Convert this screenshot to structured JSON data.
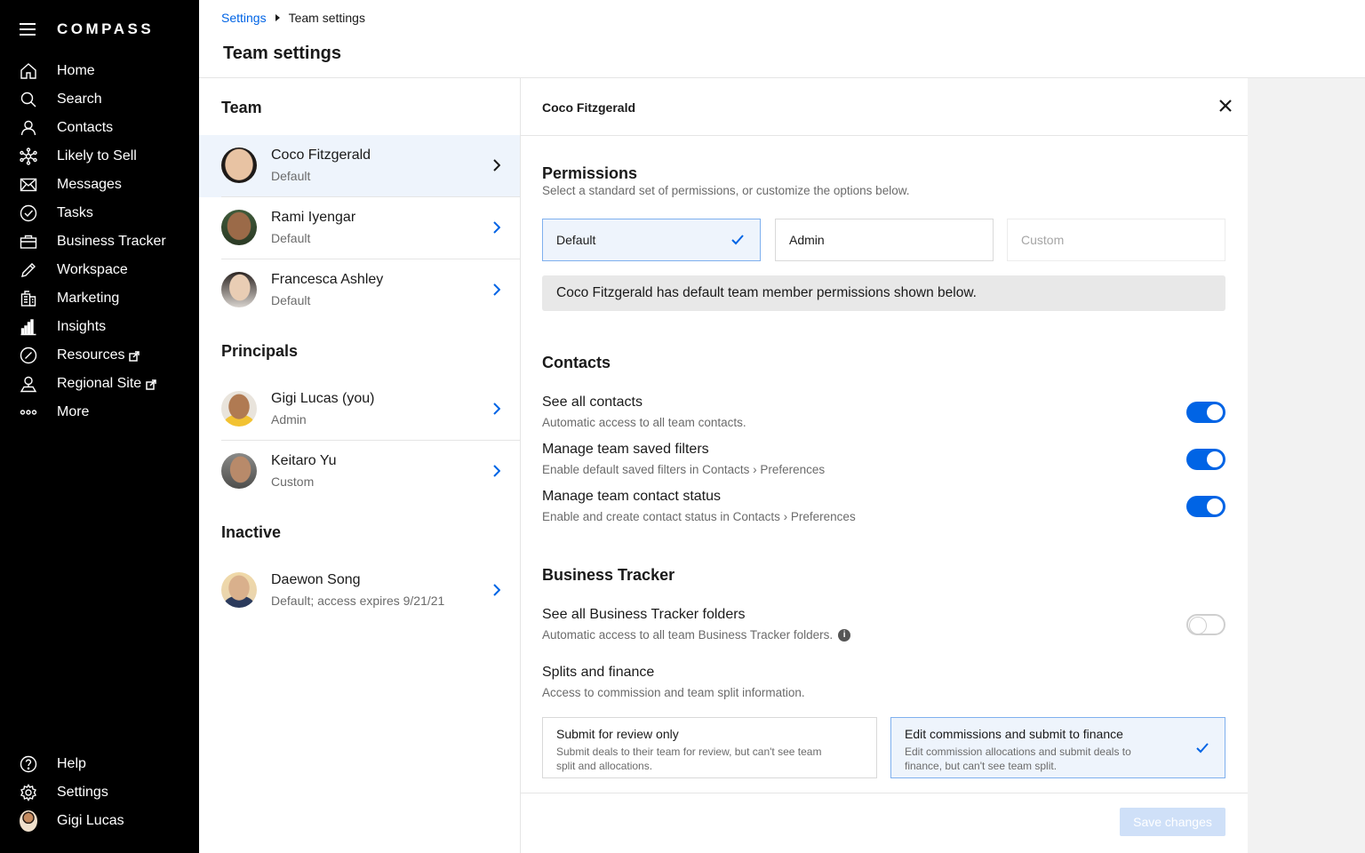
{
  "app": {
    "logo": "COMPASS"
  },
  "sidebar": {
    "items": [
      {
        "label": "Home",
        "icon": "home-icon"
      },
      {
        "label": "Search",
        "icon": "search-icon"
      },
      {
        "label": "Contacts",
        "icon": "contacts-icon"
      },
      {
        "label": "Likely to Sell",
        "icon": "network-icon"
      },
      {
        "label": "Messages",
        "icon": "mail-icon"
      },
      {
        "label": "Tasks",
        "icon": "check-circle-icon"
      },
      {
        "label": "Business Tracker",
        "icon": "briefcase-icon"
      },
      {
        "label": "Workspace",
        "icon": "pencil-icon"
      },
      {
        "label": "Marketing",
        "icon": "building-icon"
      },
      {
        "label": "Insights",
        "icon": "bar-chart-icon"
      },
      {
        "label": "Resources",
        "icon": "compass-icon",
        "external": true
      },
      {
        "label": "Regional Site",
        "icon": "map-pin-icon",
        "external": true
      },
      {
        "label": "More",
        "icon": "more-dots-icon"
      }
    ],
    "bottom": [
      {
        "label": "Help",
        "icon": "help-icon"
      },
      {
        "label": "Settings",
        "icon": "gear-icon"
      },
      {
        "label": "Gigi Lucas",
        "icon": "avatar"
      }
    ]
  },
  "header": {
    "breadcrumb": {
      "parent": "Settings",
      "current": "Team settings"
    },
    "title": "Team settings"
  },
  "team": {
    "sections": [
      {
        "title": "Team",
        "members": [
          {
            "name": "Coco Fitzgerald",
            "role": "Default",
            "selected": true
          },
          {
            "name": "Rami Iyengar",
            "role": "Default"
          },
          {
            "name": "Francesca Ashley",
            "role": "Default"
          }
        ]
      },
      {
        "title": "Principals",
        "members": [
          {
            "name": "Gigi Lucas (you)",
            "role": "Admin"
          },
          {
            "name": "Keitaro Yu",
            "role": "Custom"
          }
        ]
      },
      {
        "title": "Inactive",
        "members": [
          {
            "name": "Daewon Song",
            "role": "Default; access expires 9/21/21"
          }
        ]
      }
    ]
  },
  "detail": {
    "name": "Coco Fitzgerald",
    "permissions": {
      "title": "Permissions",
      "subtitle": "Select a standard set of permissions, or customize the options below.",
      "options": [
        "Default",
        "Admin",
        "Custom"
      ],
      "notice": "Coco Fitzgerald has default team member permissions shown below."
    },
    "contacts": {
      "title": "Contacts",
      "rows": [
        {
          "title": "See all contacts",
          "desc": "Automatic access to all team contacts.",
          "on": true
        },
        {
          "title": "Manage team saved filters",
          "desc": "Enable default saved filters in Contacts › Preferences",
          "on": true
        },
        {
          "title": "Manage team contact status",
          "desc": "Enable and create contact status in Contacts › Preferences",
          "on": true
        }
      ]
    },
    "business_tracker": {
      "title": "Business Tracker",
      "folders": {
        "title": "See all Business Tracker folders",
        "desc": "Automatic access to all team Business Tracker folders.",
        "on": false
      },
      "splits": {
        "title": "Splits and finance",
        "desc": "Access to commission and team split information.",
        "options": [
          {
            "title": "Submit for review only",
            "desc": "Submit deals to their team for review, but can't see team split and allocations."
          },
          {
            "title": "Edit commissions and submit to finance",
            "desc": "Edit commission allocations and submit deals to finance, but can't see team split.",
            "selected": true
          }
        ]
      }
    },
    "save_label": "Save changes"
  }
}
